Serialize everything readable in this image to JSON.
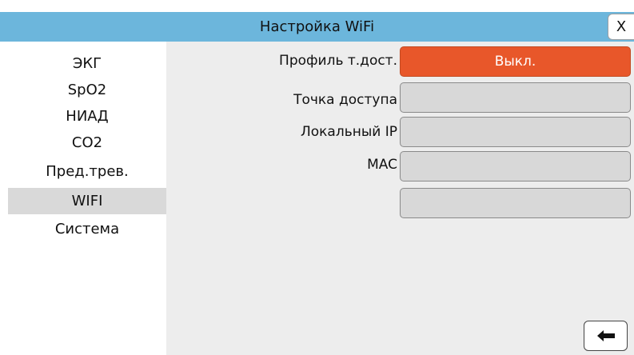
{
  "header": {
    "title": "Настройка WiFi",
    "close_label": "X"
  },
  "sidebar": {
    "items": [
      {
        "label": "ЭКГ"
      },
      {
        "label": "SpO2"
      },
      {
        "label": "НИАД"
      },
      {
        "label": "CO2"
      },
      {
        "label": "Пред.трев."
      },
      {
        "label": "WIFI",
        "active": true
      },
      {
        "label": "Система"
      }
    ]
  },
  "wifi": {
    "profile": {
      "label": "Профиль т.дост.",
      "value": "Выкл."
    },
    "access_point": {
      "label": "Точка доступа",
      "value": ""
    },
    "local_ip": {
      "label": "Локальный IP",
      "value": ""
    },
    "mac": {
      "label": "MAC",
      "value": ""
    },
    "extra": {
      "value": ""
    }
  },
  "footer": {
    "back_icon": "arrow-left-icon"
  },
  "colors": {
    "titlebar": "#6cb6dc",
    "toggle_off": "#e8572a",
    "panel": "#ededed",
    "field": "#d8d8d8",
    "active_item": "#d9d9d9"
  }
}
